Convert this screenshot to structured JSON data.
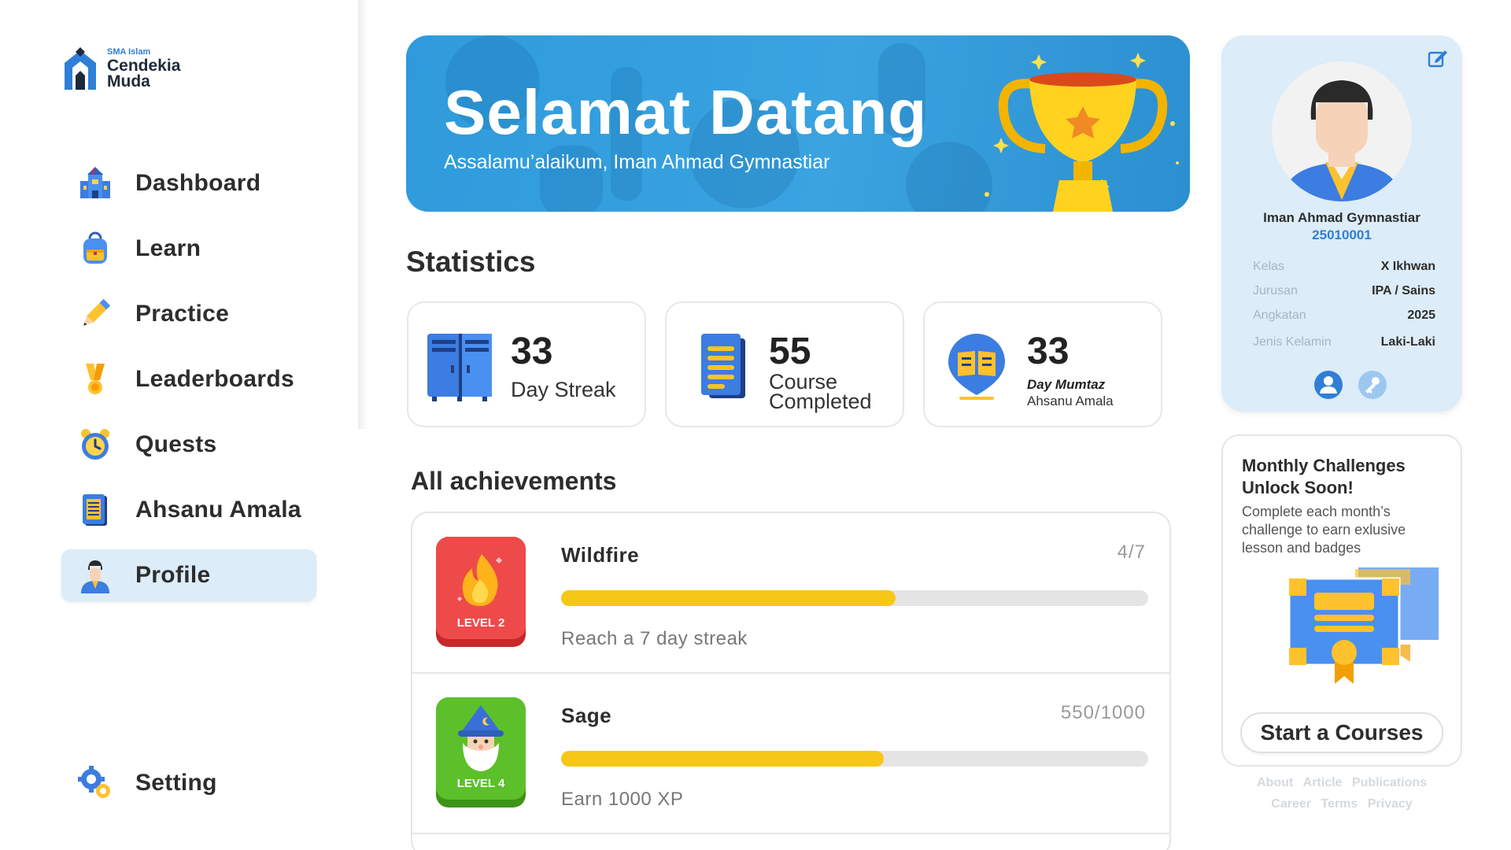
{
  "brand": {
    "sub": "SMA Islam",
    "name_line1": "Cendekia",
    "name_line2": "Muda"
  },
  "sidebar": {
    "items": [
      {
        "label": "Dashboard",
        "icon": "school-building-icon"
      },
      {
        "label": "Learn",
        "icon": "backpack-icon"
      },
      {
        "label": "Practice",
        "icon": "pencil-icon"
      },
      {
        "label": "Leaderboards",
        "icon": "medal-icon"
      },
      {
        "label": "Quests",
        "icon": "alarm-clock-icon"
      },
      {
        "label": "Ahsanu Amala",
        "icon": "notebook-icon"
      },
      {
        "label": "Profile",
        "icon": "student-avatar-icon",
        "active": true
      }
    ],
    "setting": {
      "label": "Setting",
      "icon": "gears-icon"
    }
  },
  "hero": {
    "title": "Selamat Datang",
    "subtitle": "Assalamu’alaikum, Iman Ahmad Gymnastiar"
  },
  "statistics": {
    "title": "Statistics",
    "cards": [
      {
        "value": "33",
        "label": "Day Streak",
        "icon": "locker-icon"
      },
      {
        "value": "55",
        "label_line1": "Course",
        "label_line2": "Completed",
        "icon": "document-stack-icon"
      },
      {
        "value": "33",
        "label_title": "Day Mumtaz",
        "label_sub": "Ahsanu Amala",
        "icon": "book-pin-icon"
      }
    ]
  },
  "achievements": {
    "title": "All achievements",
    "items": [
      {
        "name": "Wildfire",
        "progress_text": "4/7",
        "progress": 0.57,
        "description": "Reach a 7 day streak",
        "level": "LEVEL 2",
        "badge_color": "#ef4a4a"
      },
      {
        "name": "Sage",
        "progress_text": "550/1000",
        "progress": 0.55,
        "description": "Earn 1000 XP",
        "level": "LEVEL 4",
        "badge_color": "#5cc02a"
      }
    ]
  },
  "profile": {
    "name": "Iman Ahmad Gymnastiar",
    "id": "25010001",
    "fields": [
      {
        "key": "Kelas",
        "value": "X Ikhwan"
      },
      {
        "key": "Jurusan",
        "value": "IPA / Sains"
      },
      {
        "key": "Angkatan",
        "value": "2025"
      },
      {
        "key": "Jenis Kelamin",
        "value": "Laki-Laki"
      }
    ]
  },
  "challenges": {
    "title": "Monthly Challenges Unlock Soon!",
    "description": "Complete each month’s challenge to earn exlusive lesson and badges",
    "button": "Start a Courses"
  },
  "footer": {
    "row1": [
      "About",
      "Article",
      "Publications"
    ],
    "row2": [
      "Career",
      "Terms",
      "Privacy"
    ]
  },
  "colors": {
    "accent": "#2f9bdc",
    "active_nav": "#dcecf8",
    "progress": "#f7c718",
    "brand_blue": "#2f7fd6"
  }
}
